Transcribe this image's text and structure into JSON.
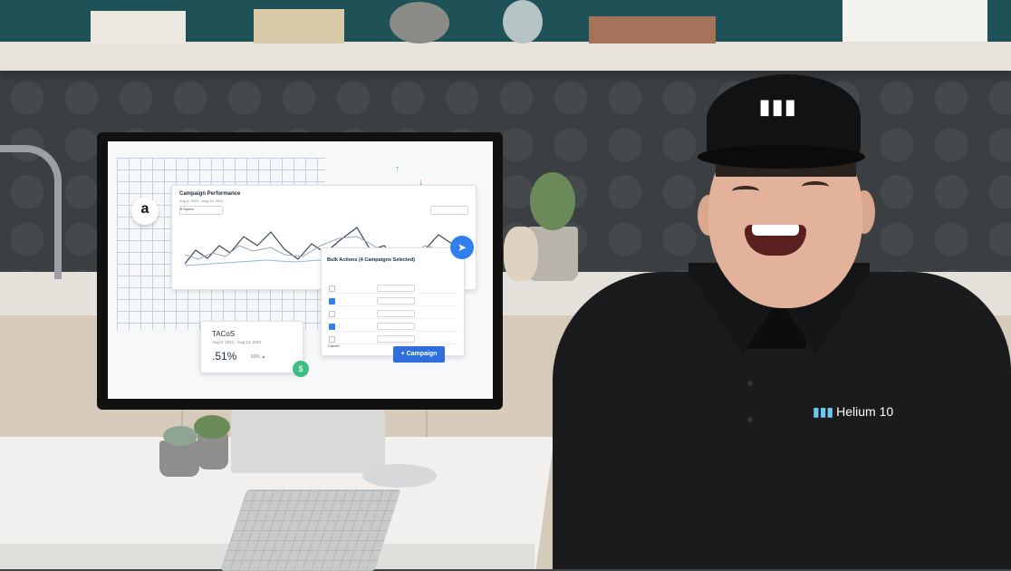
{
  "screen": {
    "amazon_logo": "a",
    "perf": {
      "title": "Campaign Performance",
      "date": "Aug 8, 2021 - Aug 13, 2021",
      "select": "▾ Spend"
    },
    "bulk": {
      "title": "Bulk Actions (4 Campaigns Selected)",
      "rows": [
        {
          "checked": false
        },
        {
          "checked": true
        },
        {
          "checked": false
        },
        {
          "checked": true
        },
        {
          "checked": false
        }
      ],
      "cancel": "Cancel",
      "button": "+ Campaign"
    },
    "tacos": {
      "title": "TACoS",
      "date": "Aug 8, 2021 - Aug 13, 2021",
      "value": ".51%",
      "delta": "50% ▲"
    },
    "icons": {
      "up": "↑",
      "down": "↓",
      "dollar": "$",
      "cursor": "➤"
    }
  },
  "shirt": {
    "brand": "Helium 10",
    "brand_icon": "▮▮▮"
  },
  "cap_logo": "▮▮▮",
  "colors": {
    "accent": "#2f6fdd",
    "green": "#3dbd80"
  }
}
